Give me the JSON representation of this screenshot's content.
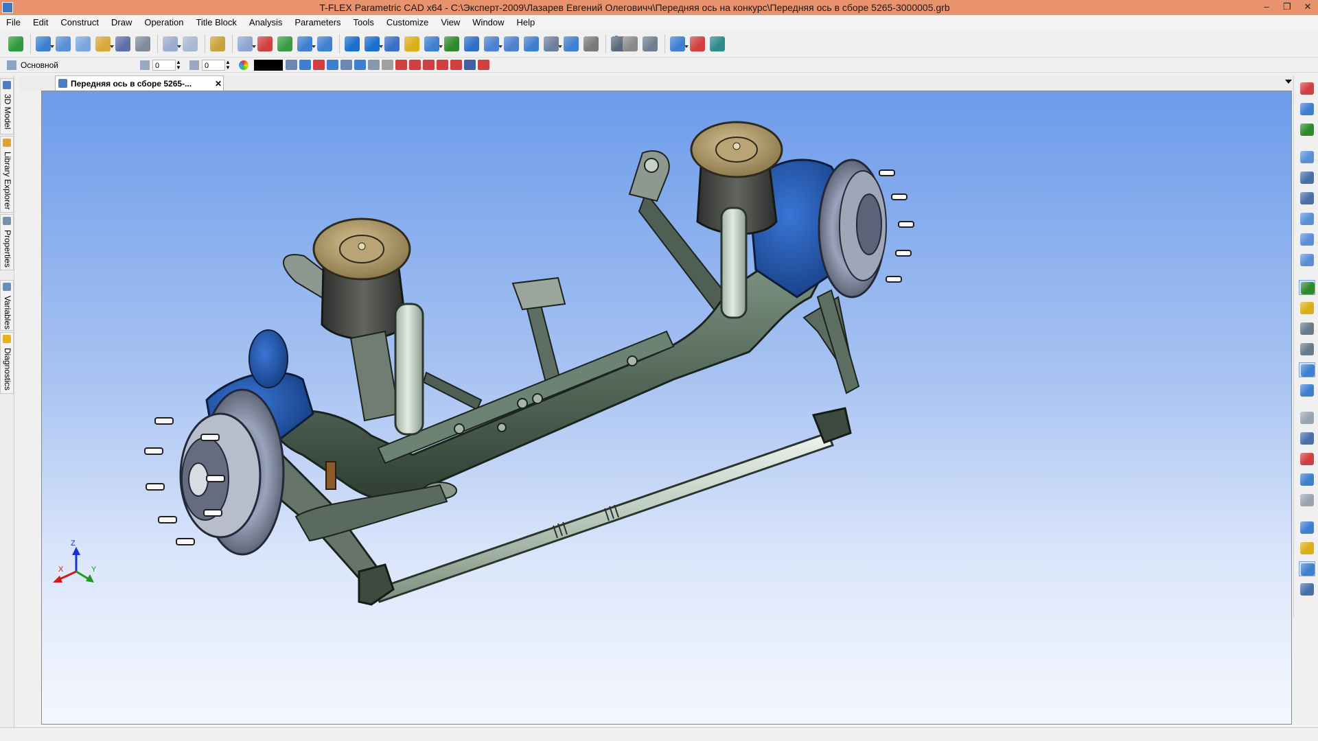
{
  "window": {
    "title": "T-FLEX Parametric CAD x64 - C:\\Эксперт-2009\\Лазарев Евгений Олеговичч\\Передняя ось на конкурс\\Передняя ось в сборе 5265-3000005.grb",
    "controls": [
      "–",
      "❐",
      "✕"
    ]
  },
  "menu": [
    "File",
    "Edit",
    "Construct",
    "Draw",
    "Operation",
    "Title Block",
    "Analysis",
    "Parameters",
    "Tools",
    "Customize",
    "View",
    "Window",
    "Help"
  ],
  "toolbar2": {
    "layer_name": "Основной",
    "level_value": "0",
    "priority_value": "0",
    "color": "#000000"
  },
  "left_tabs": [
    "3D Model",
    "Library Explorer",
    "Properties",
    "Variables",
    "Diagnostics"
  ],
  "document_tab": {
    "title": "Передняя ось в сборе 5265-...",
    "close": "✕"
  },
  "toolbar1_icons": [
    "select-icon",
    "new-document-icon",
    "new-3d-model-icon",
    "new-drawing-icon",
    "open-icon",
    "save-icon",
    "print-icon",
    "undo-icon",
    "redo-icon",
    "properties-icon",
    "view-3d-icon",
    "construct-point-icon",
    "workplane-icon",
    "axis-icon",
    "3d-node-icon",
    "extrusion-icon",
    "rotation-icon",
    "boolean-icon",
    "shell-icon",
    "loft-icon",
    "sweep-icon",
    "array-icon",
    "fillet-icon",
    "chamfer-icon",
    "cut-icon",
    "mirror-icon",
    "body-icon",
    "measure-icon",
    "dimension-icon",
    "report-icon",
    "calculator-icon",
    "link-icon",
    "assembly-icon",
    "fragment-icon"
  ],
  "toolbar1_value": "5",
  "right_icons": [
    "magnet-icon",
    "pin-icon",
    "snap-icon",
    "zoom-window-icon",
    "fit-all-icon",
    "zoom-extents-icon",
    "zoom-in-icon",
    "zoom-out-icon",
    "zoom-prev-icon",
    "constraint-icon",
    "dimension-icon",
    "move-icon",
    "rotate-icon",
    "mate-icon",
    "align-icon",
    "copy-icon",
    "grid-icon",
    "check-icon",
    "check-model-icon",
    "plane-icon",
    "view-cube-icon",
    "material-icon",
    "render-icon",
    "window-icon"
  ],
  "right_active": [
    9,
    13,
    22
  ],
  "axes": {
    "x": "X",
    "y": "Y",
    "z": "Z"
  },
  "colors": {
    "titlebar": "#e8926e",
    "axle_body": "#55695a",
    "brake_blue": "#1f4fa0",
    "air_spring": "#494c4a",
    "air_spring_top": "#a89466",
    "shock": "#c4d1c6",
    "tie_rod": "#c5d2c8"
  }
}
